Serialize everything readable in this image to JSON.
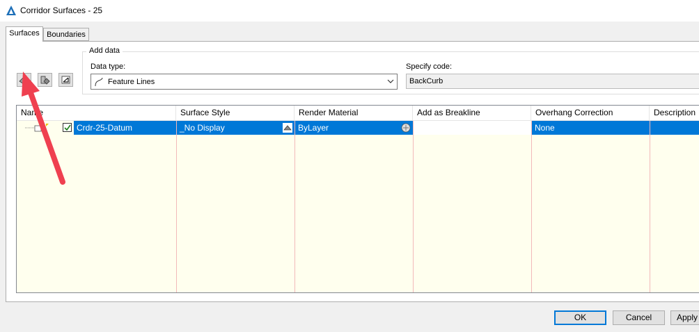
{
  "window": {
    "title": "Corridor Surfaces - 25"
  },
  "tabs": [
    {
      "label": "Surfaces",
      "active": true
    },
    {
      "label": "Boundaries",
      "active": false
    }
  ],
  "toolbar": {
    "buttons": [
      {
        "icon": "create-surface-icon"
      },
      {
        "icon": "add-data-icon"
      },
      {
        "icon": "delete-icon"
      }
    ]
  },
  "add_data": {
    "group_label": "Add data",
    "data_type_label": "Data type:",
    "data_type_value": "Feature Lines",
    "specify_code_label": "Specify code:",
    "specify_code_value": "BackCurb"
  },
  "table": {
    "columns": [
      "Name",
      "Surface Style",
      "Render Material",
      "Add as Breakline",
      "Overhang Correction",
      "Description"
    ],
    "rows": [
      {
        "name": "Crdr-25-Datum",
        "checked": true,
        "surface_style": "_No Display",
        "render_material": "ByLayer",
        "add_as_breakline": "",
        "overhang_correction": "None",
        "description": ""
      }
    ]
  },
  "buttons": {
    "ok": "OK",
    "cancel": "Cancel",
    "apply": "Apply"
  },
  "colors": {
    "selection": "#0078d7",
    "grid_background": "#ffffee",
    "annotation_arrow": "#ef4050"
  }
}
